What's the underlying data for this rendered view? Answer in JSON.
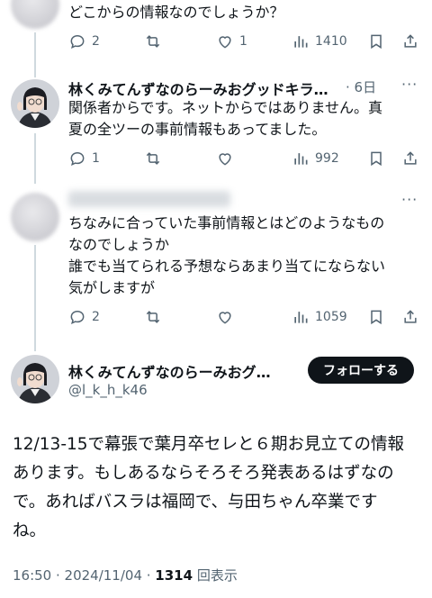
{
  "reply1": {
    "text": "どこからの情報なのでしょうか？",
    "replies": "2",
    "likes": "1",
    "views": "1410"
  },
  "reply2": {
    "name": "林くみてんずなのらーみおグッドキラ…",
    "time": "· 6日",
    "text_line1": "関係者からです。ネットからではありません。真",
    "text_line2": "夏の全ツーの事前情報もあってました。",
    "replies": "1",
    "views": "992"
  },
  "reply3": {
    "text_line1": "ちなみに合っていた事前情報とはどのようなもの",
    "text_line2": "なのでしょうか",
    "text_line3": "誰でも当てられる予想ならあまり当てにならない",
    "text_line4": "気がしますが",
    "replies": "2",
    "views": "1059"
  },
  "main_tweet": {
    "name": "林くみてんずなのらーみおグ…",
    "handle": "@l_k_h_k46",
    "follow_label": "フォローする",
    "line1": "12/13-15で幕張で葉月卒セレと６期お見立ての情報",
    "line2": "あります。もしあるならそろそろ発表あるはずなの",
    "line3": "で。あればバスラは福岡で、与田ちゃん卒業です",
    "line4": "ね。",
    "time": "16:50 · 2024/11/04 · ",
    "views_count": "1314",
    "views_label": " 回表示"
  },
  "icons": [
    "reply-icon",
    "retweet-icon",
    "like-icon",
    "views-icon",
    "bookmark-icon",
    "share-icon",
    "more-icon"
  ],
  "colors": {
    "text": "#0f1419",
    "secondary": "#536471",
    "button": "#0f1419",
    "line": "#cfd9de"
  }
}
